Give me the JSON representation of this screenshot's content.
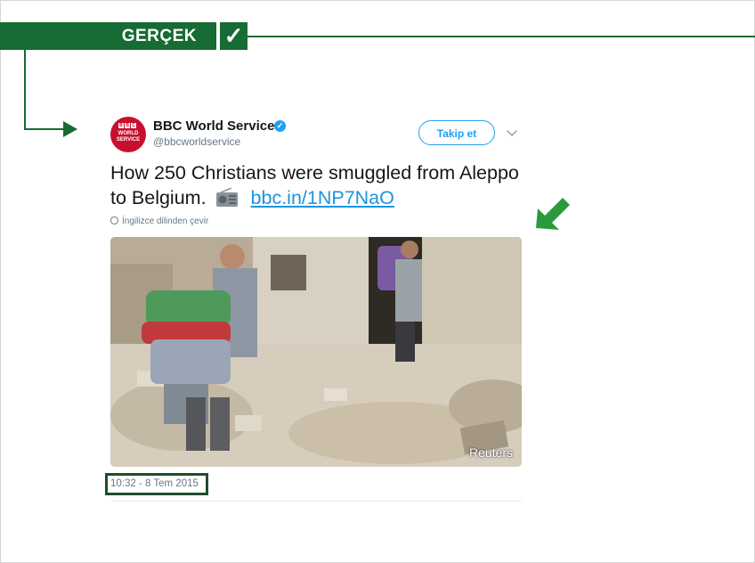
{
  "verdict": {
    "label": "GERÇEK",
    "check_glyph": "✓",
    "color": "#176b34"
  },
  "tweet": {
    "account_name": "BBC World Service",
    "handle": "@bbcworldservice",
    "avatar": {
      "logo_letters": [
        "B",
        "B",
        "C"
      ],
      "line1": "WORLD",
      "line2": "SERVICE",
      "color": "#c8102e"
    },
    "verified_glyph": "✓",
    "follow_label": "Takip et",
    "text": "How 250 Christians were smuggled from Aleppo to Belgium.",
    "link": "bbc.in/1NP7NaO",
    "translate_label": "İngilizce dilinden çevir",
    "photo_credit": "Reuters",
    "timestamp": "10:32 - 8 Tem 2015",
    "link_color": "#1b95e0"
  },
  "icons": [
    "check-icon",
    "verified-badge-icon",
    "chevron-down-icon",
    "radio-emoji-icon",
    "globe-icon",
    "arrow-right-icon",
    "arrow-down-left-icon"
  ]
}
